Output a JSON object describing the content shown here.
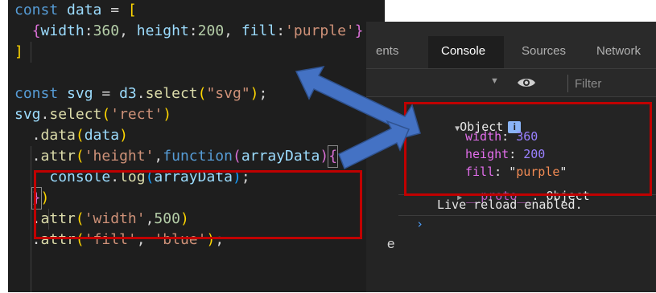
{
  "editor": {
    "lines": [
      [
        {
          "t": "const ",
          "c": "kw"
        },
        {
          "t": "data",
          "c": "var"
        },
        {
          "t": " = ",
          "c": "pl"
        },
        {
          "t": "[",
          "c": "br1"
        }
      ],
      [
        {
          "t": "  ",
          "c": "pl"
        },
        {
          "t": "{",
          "c": "br2"
        },
        {
          "t": "width",
          "c": "var"
        },
        {
          "t": ":",
          "c": "pl"
        },
        {
          "t": "360",
          "c": "num"
        },
        {
          "t": ", ",
          "c": "pl"
        },
        {
          "t": "height",
          "c": "var"
        },
        {
          "t": ":",
          "c": "pl"
        },
        {
          "t": "200",
          "c": "num"
        },
        {
          "t": ", ",
          "c": "pl"
        },
        {
          "t": "fill",
          "c": "var"
        },
        {
          "t": ":",
          "c": "pl"
        },
        {
          "t": "'purple'",
          "c": "str"
        },
        {
          "t": "}",
          "c": "br2"
        }
      ],
      [
        {
          "t": "]",
          "c": "br1"
        }
      ],
      [],
      [
        {
          "t": "const ",
          "c": "kw"
        },
        {
          "t": "svg",
          "c": "var"
        },
        {
          "t": " = ",
          "c": "pl"
        },
        {
          "t": "d3",
          "c": "var"
        },
        {
          "t": ".",
          "c": "pl"
        },
        {
          "t": "select",
          "c": "fn"
        },
        {
          "t": "(",
          "c": "br1"
        },
        {
          "t": "\"svg\"",
          "c": "str"
        },
        {
          "t": ")",
          "c": "br1"
        },
        {
          "t": ";",
          "c": "pl"
        }
      ],
      [
        {
          "t": "svg",
          "c": "var"
        },
        {
          "t": ".",
          "c": "pl"
        },
        {
          "t": "select",
          "c": "fn"
        },
        {
          "t": "(",
          "c": "br1"
        },
        {
          "t": "'rect'",
          "c": "str"
        },
        {
          "t": ")",
          "c": "br1"
        }
      ],
      [
        {
          "t": "  .",
          "c": "pl"
        },
        {
          "t": "data",
          "c": "fn"
        },
        {
          "t": "(",
          "c": "br1"
        },
        {
          "t": "data",
          "c": "var"
        },
        {
          "t": ")",
          "c": "br1"
        }
      ],
      [
        {
          "t": "  .",
          "c": "pl"
        },
        {
          "t": "attr",
          "c": "fn"
        },
        {
          "t": "(",
          "c": "br1"
        },
        {
          "t": "'height'",
          "c": "str"
        },
        {
          "t": ",",
          "c": "pl"
        },
        {
          "t": "function",
          "c": "kw"
        },
        {
          "t": "(",
          "c": "br2"
        },
        {
          "t": "arrayData",
          "c": "var"
        },
        {
          "t": ")",
          "c": "br2"
        },
        {
          "t": "{",
          "c": "br2",
          "box": true
        }
      ],
      [
        {
          "t": "    ",
          "c": "pl"
        },
        {
          "t": "console",
          "c": "var"
        },
        {
          "t": ".",
          "c": "pl"
        },
        {
          "t": "log",
          "c": "fn"
        },
        {
          "t": "(",
          "c": "br3"
        },
        {
          "t": "arrayData",
          "c": "var"
        },
        {
          "t": ")",
          "c": "br3"
        },
        {
          "t": ";",
          "c": "pl"
        }
      ],
      [
        {
          "t": "  ",
          "c": "pl"
        },
        {
          "t": "}",
          "c": "br2",
          "box": true
        },
        {
          "t": ")",
          "c": "br1"
        }
      ],
      [
        {
          "t": "  .",
          "c": "pl"
        },
        {
          "t": "attr",
          "c": "fn"
        },
        {
          "t": "(",
          "c": "br1"
        },
        {
          "t": "'width'",
          "c": "str"
        },
        {
          "t": ",",
          "c": "pl"
        },
        {
          "t": "500",
          "c": "num"
        },
        {
          "t": ")",
          "c": "br1"
        }
      ],
      [
        {
          "t": "  .",
          "c": "pl"
        },
        {
          "t": "attr",
          "c": "fn"
        },
        {
          "t": "(",
          "c": "br1"
        },
        {
          "t": "'fill'",
          "c": "str"
        },
        {
          "t": ", ",
          "c": "pl"
        },
        {
          "t": "'blue'",
          "c": "str"
        },
        {
          "t": ")",
          "c": "br1"
        },
        {
          "t": ";",
          "c": "pl"
        }
      ]
    ]
  },
  "devtools": {
    "tabs": [
      "ents",
      "Console",
      "Sources",
      "Network"
    ],
    "active_tab": "Console",
    "filter_placeholder": "Filter",
    "partial_left_char": "e",
    "console": {
      "object_label": "Object",
      "info_badge": "i",
      "props": [
        {
          "key": "width",
          "value": "360",
          "kind": "number"
        },
        {
          "key": "height",
          "value": "200",
          "kind": "number"
        },
        {
          "key": "fill",
          "value": "purple",
          "kind": "string"
        }
      ],
      "proto_key": "__proto__",
      "proto_value": "Object",
      "live_reload_message": "Live reload enabled."
    }
  },
  "colors": {
    "annotation_red": "#c00000",
    "arrow_blue": "#4472c4",
    "arrow_outline": "#2f528f",
    "editor_bg": "#1e1e1e",
    "devtools_bg": "#242424"
  }
}
